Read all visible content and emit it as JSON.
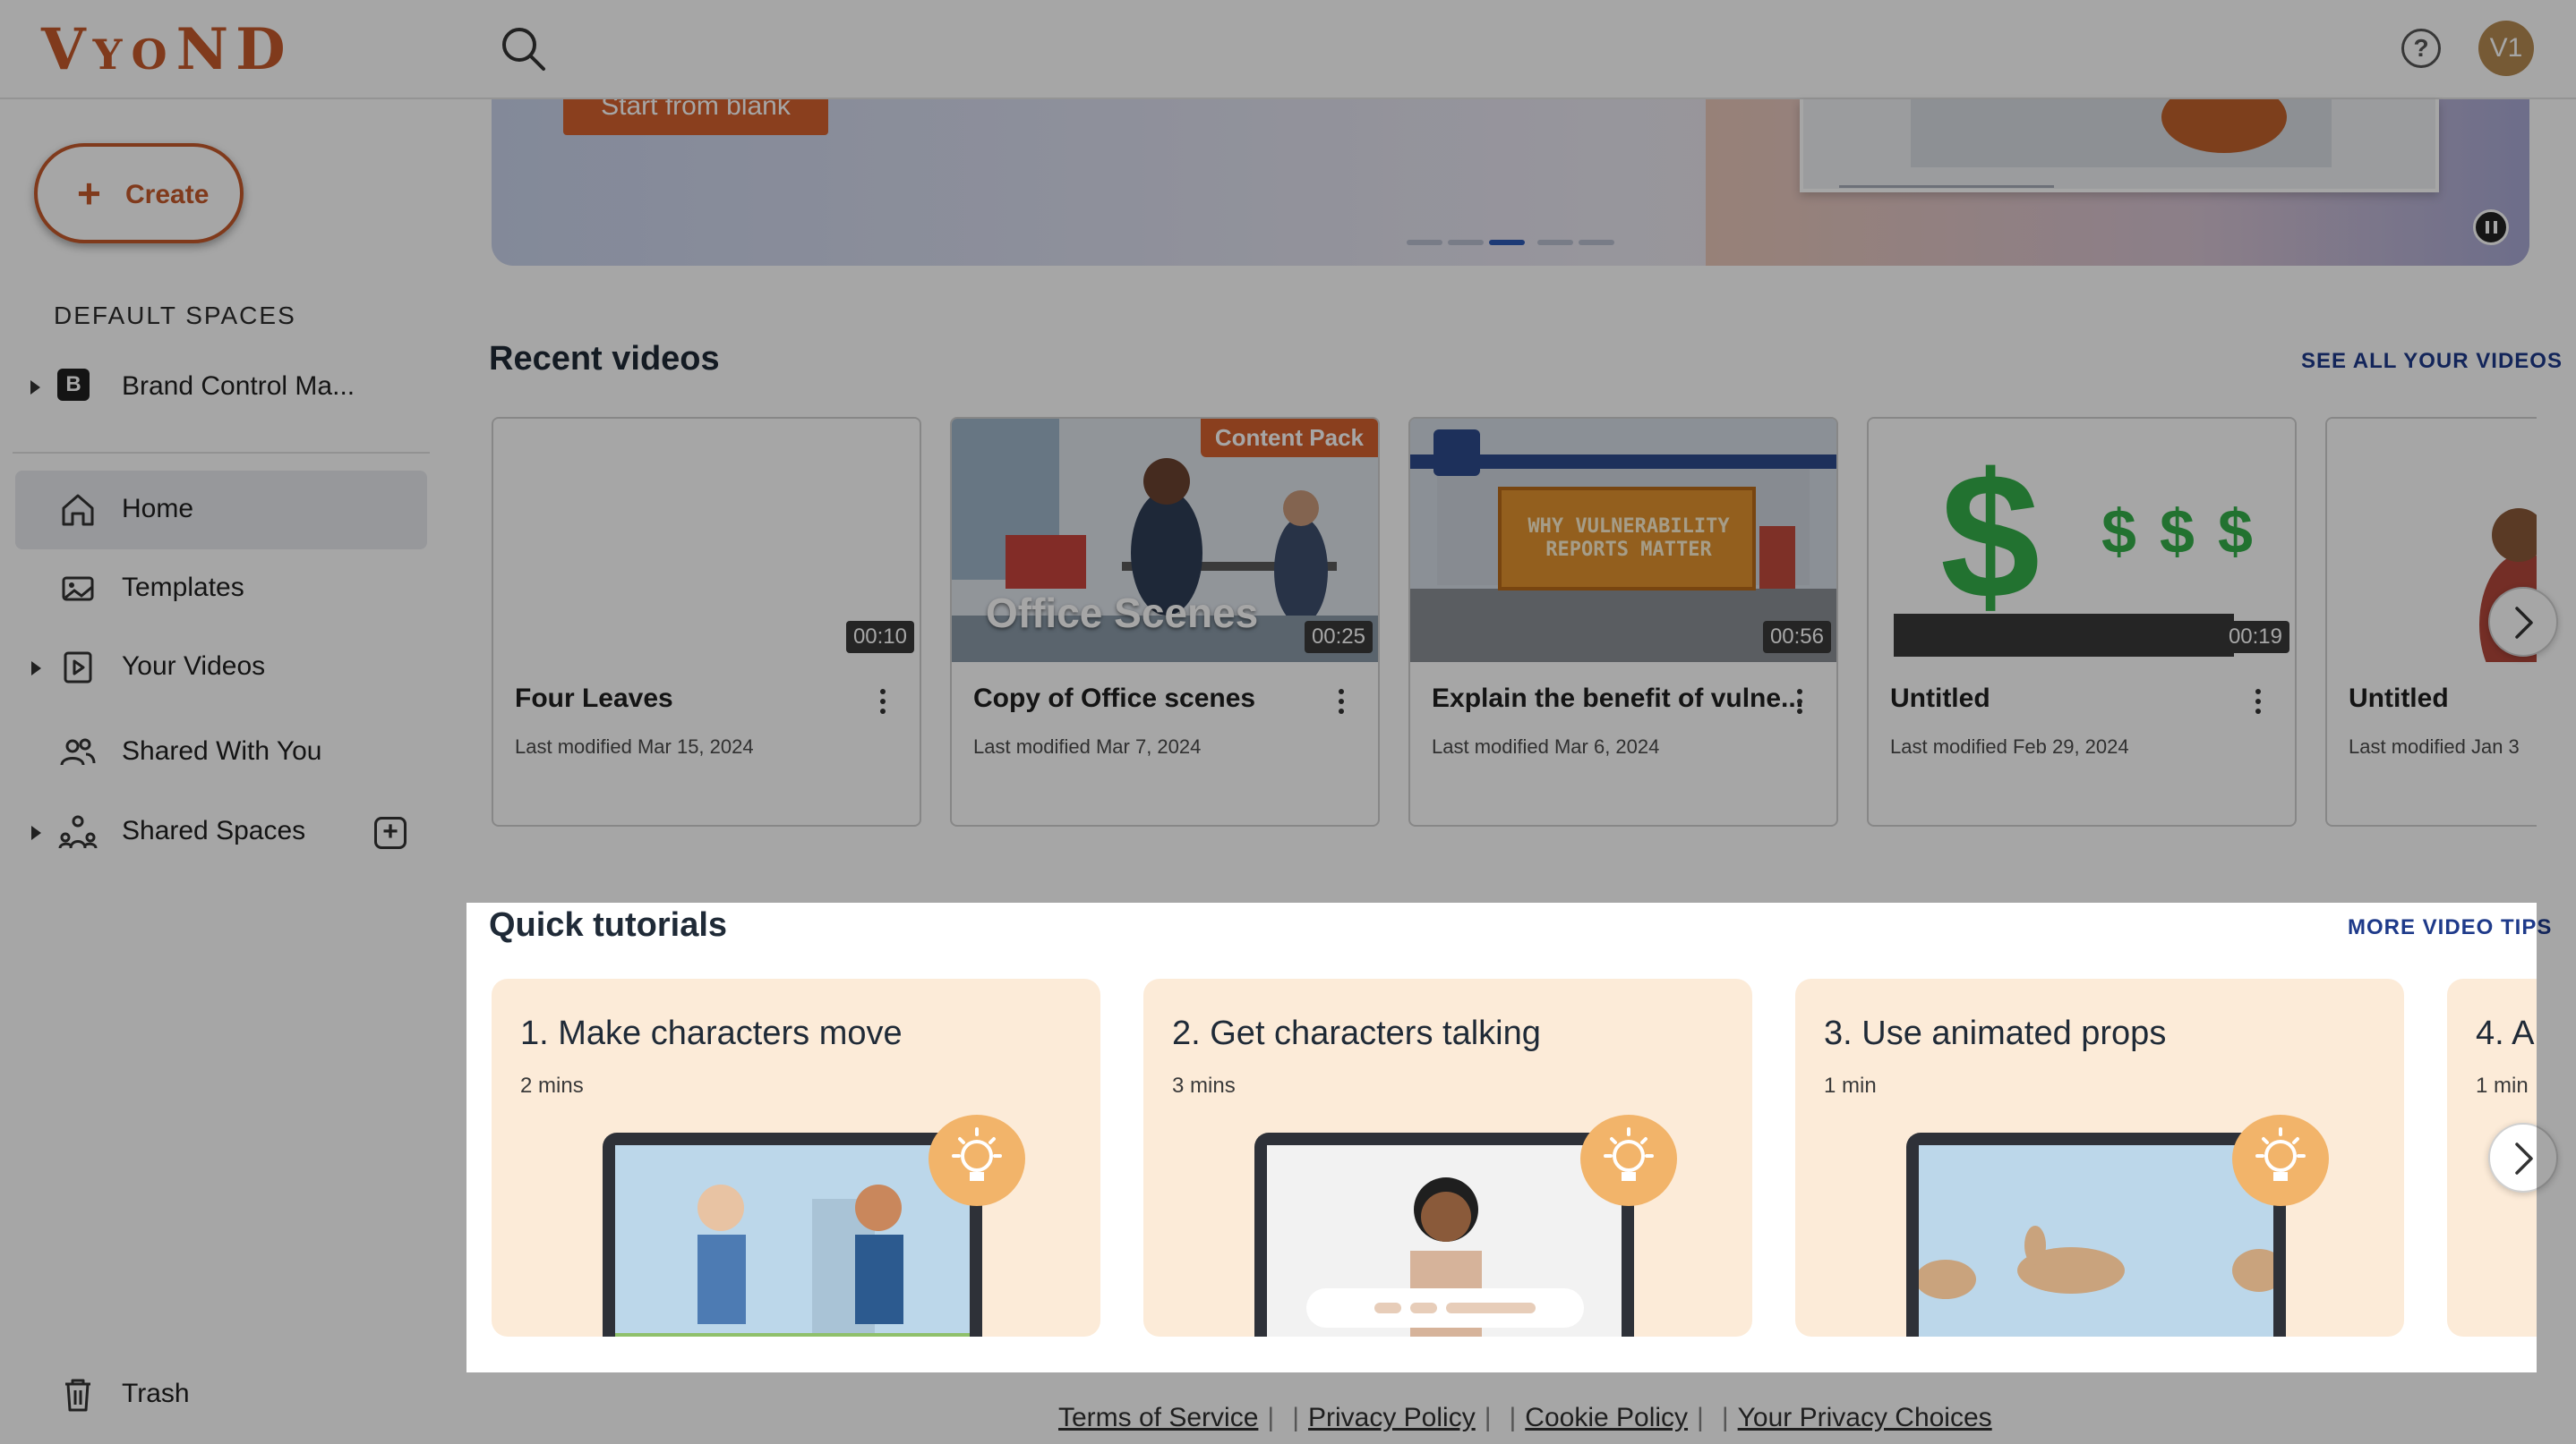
{
  "app": {
    "logo": "VYOND"
  },
  "header": {
    "help": "?",
    "avatar_initials": "V1"
  },
  "sidebar": {
    "create_label": "Create",
    "default_spaces_heading": "DEFAULT SPACES",
    "brand_space": {
      "badge": "B",
      "label": "Brand Control Ma..."
    },
    "nav": [
      {
        "label": "Home",
        "icon": "home-icon"
      },
      {
        "label": "Templates",
        "icon": "templates-icon"
      },
      {
        "label": "Your Videos",
        "icon": "video-icon"
      },
      {
        "label": "Shared With You",
        "icon": "people-icon"
      },
      {
        "label": "Shared Spaces",
        "icon": "shared-spaces-icon"
      }
    ],
    "trash_label": "Trash"
  },
  "banner": {
    "button_label": "Start from blank",
    "slide_count": 5,
    "active_slide": 3
  },
  "recent": {
    "title": "Recent videos",
    "see_all": "SEE ALL YOUR VIDEOS",
    "videos": [
      {
        "title": "Four Leaves",
        "modified": "Last modified Mar 15, 2024",
        "duration": "00:10"
      },
      {
        "title": "Copy of Office scenes",
        "modified": "Last modified Mar 7, 2024",
        "duration": "00:25",
        "badge": "Content Pack",
        "thumb_text": "Office Scenes"
      },
      {
        "title": "Explain the benefit of vulne...",
        "modified": "Last modified Mar 6, 2024",
        "duration": "00:56",
        "thumb_text": "WHY VULNERABILITY REPORTS MATTER"
      },
      {
        "title": "Untitled",
        "modified": "Last modified Feb 29, 2024",
        "duration": "00:19"
      },
      {
        "title": "Untitled",
        "modified": "Last modified Jan 3"
      }
    ]
  },
  "tutorials": {
    "title": "Quick tutorials",
    "more": "MORE VIDEO TIPS",
    "items": [
      {
        "title": "1. Make characters move",
        "duration": "2 mins"
      },
      {
        "title": "2. Get characters talking",
        "duration": "3 mins"
      },
      {
        "title": "3. Use animated props",
        "duration": "1 min"
      },
      {
        "title": "4. A",
        "duration": "1 min"
      }
    ]
  },
  "footer": {
    "links": [
      "Terms of Service",
      "Privacy Policy",
      "Cookie Policy",
      "Your Privacy Choices"
    ],
    "separator": "|"
  },
  "colors": {
    "brand": "#c55a2b",
    "link": "#1e3a8a",
    "tutorial_card": "#fcebd8"
  }
}
